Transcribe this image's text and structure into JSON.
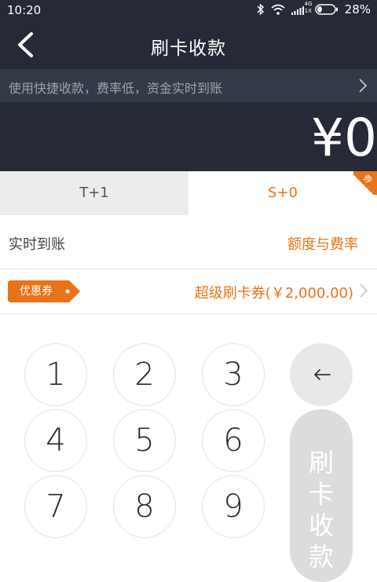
{
  "status": {
    "time": "10:20",
    "network": "4G",
    "network_sub": "1X",
    "battery": "28%",
    "battery_level": 0.28
  },
  "header": {
    "title": "刷卡收款"
  },
  "promo": {
    "text": "使用快捷收款，费率低，资金实时到账"
  },
  "amount": {
    "value": "¥0"
  },
  "tabs": [
    {
      "label": "T+1",
      "selected": false
    },
    {
      "label": "S+0",
      "selected": true,
      "badge": "券"
    }
  ],
  "settlement": {
    "label": "实时到账",
    "fee_link": "额度与费率"
  },
  "coupon": {
    "tag": "优惠券",
    "name": "超级刷卡券(￥2,000.00)"
  },
  "keypad": {
    "keys": [
      "1",
      "2",
      "3",
      "4",
      "5",
      "6",
      "7",
      "8",
      "9"
    ],
    "submit": [
      "刷",
      "卡",
      "收",
      "款"
    ]
  },
  "colors": {
    "accent": "#e87318",
    "header_bg": "#262a36",
    "promo_bg": "#353a48"
  },
  "icons": {
    "back": "back-arrow-icon",
    "chevron": "chevron-right-icon",
    "backspace": "backspace-arrow-icon"
  }
}
